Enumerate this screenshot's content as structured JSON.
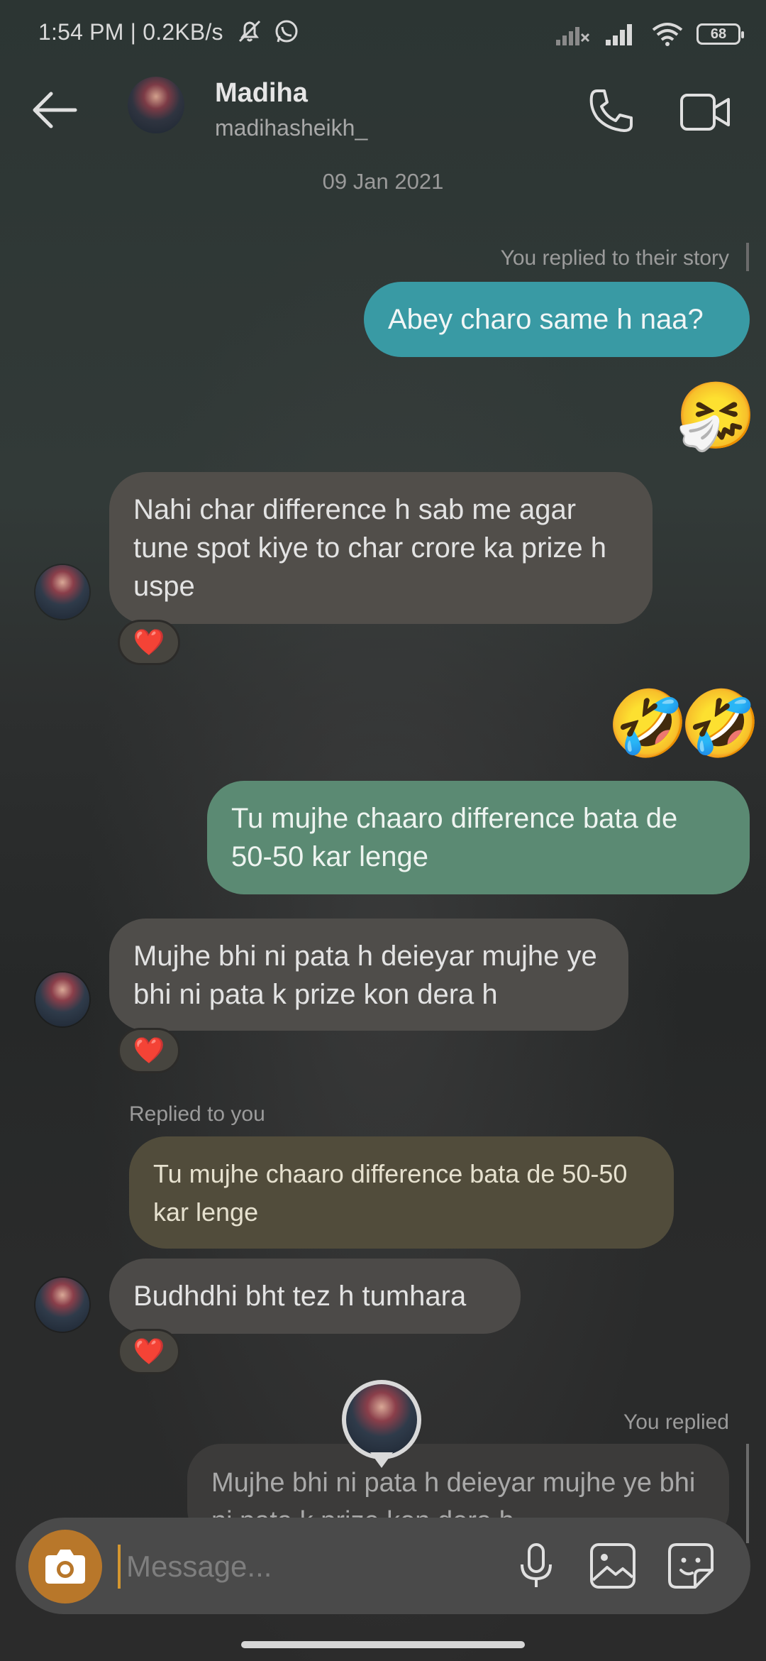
{
  "status": {
    "time_speed": "1:54 PM | 0.2KB/s",
    "battery": "68",
    "icons": [
      "mute-bell-icon",
      "whatsapp-icon",
      "signal-no-icon",
      "signal-icon",
      "wifi-icon",
      "battery-icon"
    ]
  },
  "header": {
    "name": "Madiha",
    "username": "madihasheikh_"
  },
  "date_separator": "09 Jan 2021",
  "messages": {
    "story_reply_label": "You replied to their story",
    "out1": "Abey charo same h naa?",
    "emoji_sneeze": "🤧",
    "in1": "Nahi char difference h sab me agar tune spot kiye to char crore ka prize h uspe",
    "emoji_laugh": "🤣",
    "out2": "Tu mujhe chaaro difference bata de 50-50 kar lenge",
    "in2": "Mujhe bhi ni pata h deieyar mujhe ye bhi ni pata k prize kon dera h",
    "replied_to_you_label": "Replied to you",
    "quoted": "Tu mujhe chaaro difference bata de 50-50 kar lenge",
    "in3": "Budhdhi bht tez h tumhara",
    "you_replied_label": "You replied",
    "reply_out": "Mujhe bhi ni pata h deieyar mujhe ye bhi ni pata k prize kon dera h",
    "reaction": "❤️"
  },
  "composer": {
    "placeholder": "Message..."
  },
  "colors": {
    "outgoing_teal": "#399aa4",
    "outgoing_green": "#5b8a73",
    "incoming": "#514e4a",
    "camera": "#b8772a",
    "heart": "#e0262d"
  }
}
